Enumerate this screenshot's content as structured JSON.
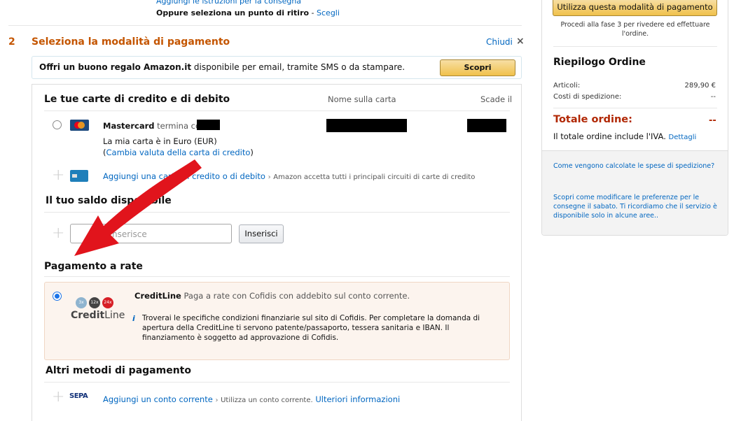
{
  "delivery": {
    "add_instructions": "Aggiungi le istruzioni per la consegna",
    "pickup_text": "Oppure seleziona un punto di ritiro",
    "pickup_sep": " - ",
    "pickup_link": "Scegli"
  },
  "step": {
    "number": "2",
    "title": "Seleziona la modalità di pagamento",
    "close_label": "Chiudi",
    "close_icon": "×"
  },
  "gift": {
    "bold": "Offri un buono regalo Amazon.it",
    "rest": " disponibile per email, tramite SMS o da stampare.",
    "button": "Scopri"
  },
  "cards": {
    "title": "Le tue carte di credito e di debito",
    "col_name": "Nome sulla carta",
    "col_expiry": "Scade il",
    "card_brand": "Mastercard",
    "card_suffix": " termina con",
    "currency_line": "La mia carta è in Euro (EUR)",
    "change_currency_open": "(",
    "change_currency_link": "Cambia valuta della carta di credito",
    "change_currency_close": ")",
    "add_link": "Aggiungi una carta di credito o di debito",
    "add_chevron": "›",
    "add_note": "Amazon accetta tutti i principali circuiti di carte di credito"
  },
  "balance": {
    "title": "Il tuo saldo disponibile",
    "input_placeholder": "nserisce",
    "button": "Inserisci"
  },
  "installments": {
    "title": "Pagamento a rate",
    "brand": "CreditLine",
    "desc": " Paga a rate con Cofidis con addebito sul conto corrente.",
    "logo_text_bold": "Credit",
    "logo_text_light": "Line",
    "badges": [
      "3x",
      "12x",
      "24x"
    ],
    "info_icon": "i",
    "finance_text": "Troverai le specifiche condizioni finanziarie sul sito di Cofidis. Per completare la domanda di apertura della CreditLine ti servono patente/passaporto, tessera sanitaria e IBAN. Il finanziamento è soggetto ad approvazione di Cofidis."
  },
  "other": {
    "title": "Altri metodi di pagamento",
    "sepa_logo": "SEPA",
    "add_account_link": "Aggiungi un conto corrente",
    "chevron": "›",
    "note": "Utilizza un conto corrente.",
    "more_link": "Ulteriori informazioni"
  },
  "summary": {
    "use_button": "Utilizza questa modalità di pagamento",
    "proceed_text": "Procedi alla fase 3 per rivedere ed effettuare l'ordine.",
    "title": "Riepilogo Ordine",
    "items_label": "Articoli:",
    "items_value": "289,90 €",
    "shipping_label": "Costi di spedizione:",
    "shipping_value": "--",
    "total_label": "Totale ordine:",
    "total_value": "--",
    "vat_text": "Il totale ordine include l'IVA.",
    "vat_link": "Dettagli",
    "shipping_calc_link": "Come vengono calcolate le spese di spedizione?",
    "saturday_link": "Scopri come modificare le preferenze per le consegne il sabato. Ti ricordiamo che il servizio è disponibile solo in alcune aree.."
  },
  "colors": {
    "accent_orange": "#c45500",
    "link_blue": "#0066c0",
    "total_red": "#b12704",
    "annotation_red": "#e1141c"
  },
  "icons": {
    "radio": "radio-icon",
    "mastercard": "mastercard-icon",
    "card": "credit-card-icon",
    "plus": "plus-icon",
    "info": "info-icon",
    "arrow": "red-arrow-annotation"
  }
}
